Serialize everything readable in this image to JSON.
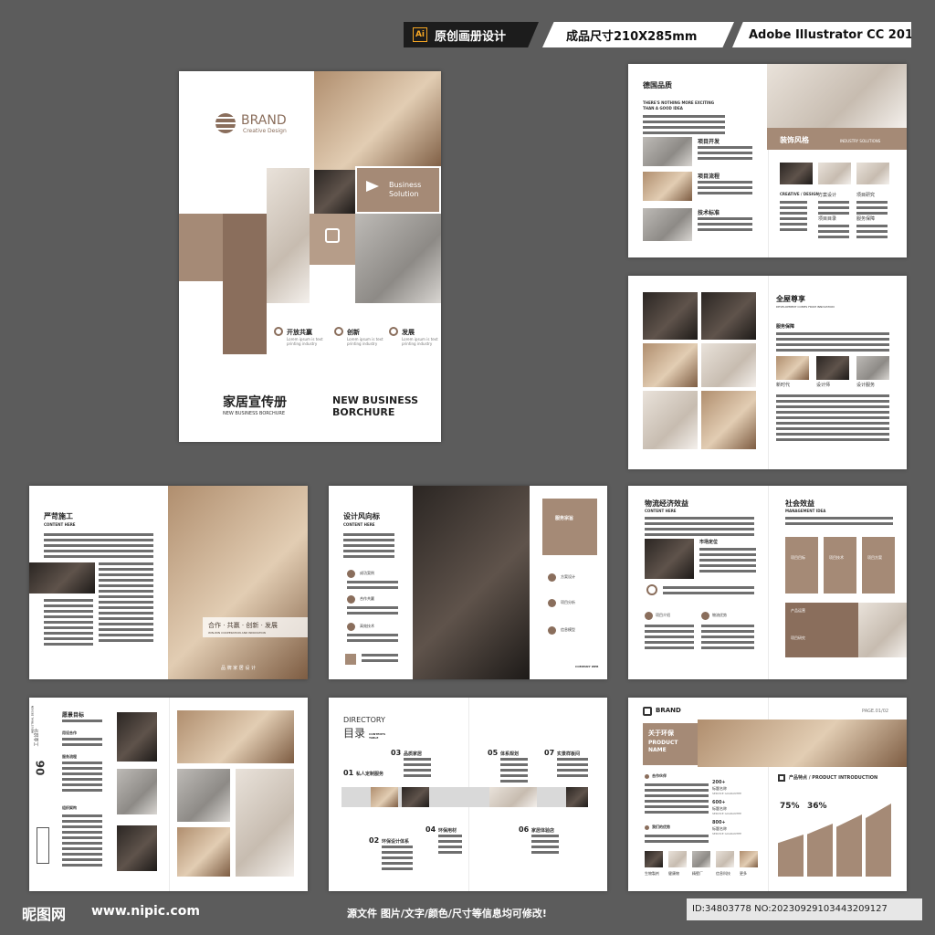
{
  "header": {
    "ai_icon": "Ai",
    "badge1": "原创画册设计",
    "badge2": "成品尺寸210X285mm",
    "badge3": "Adobe Illustrator CC 2018"
  },
  "cover": {
    "brand": "BRAND",
    "brand_sub": "Creative Design",
    "business": "Business",
    "solution": "Solution",
    "features": [
      {
        "label": "开放共赢",
        "text": "Lorem ipsum is text printing industry"
      },
      {
        "label": "创新",
        "text": "Lorem ipsum is text printing industry"
      },
      {
        "label": "发展",
        "text": "Lorem ipsum is text printing industry"
      }
    ],
    "title_cn": "家居宣传册",
    "title_en_small": "NEW BUSINESS BORCHURE",
    "title_en_1": "NEW BUSINESS",
    "title_en_2": "BORCHURE"
  },
  "spread1": {
    "title": "德国品质",
    "tagline_1": "THERE'S NOTHING MORE EXCITING",
    "tagline_2": "THAN A GOOD IDEA",
    "items": [
      "项目开发",
      "项目流程",
      "技术标准"
    ],
    "banner": "装饰风格",
    "banner_en": "INDUSTRY SOLUTIONS",
    "sub_left": "CREATIVE / DESIGN",
    "sub_items": [
      "方案设计",
      "项目研究",
      "项目目录",
      "服务保障",
      "项目目标",
      "服务技术"
    ]
  },
  "spread2": {
    "title": "全屋尊享",
    "subtitle": "DEVELOPMENT COMES FROM INNOVATION",
    "label": "服务保障",
    "caps": [
      "新时代",
      "设计师",
      "设计服务"
    ]
  },
  "spread3": {
    "title": "严苛施工",
    "content": "CONTENT HERE",
    "ribbon": "合作 · 共赢 · 创新 · 发展",
    "ribbon_en": "WIN-WIN COOPERATION AND INNOVATION",
    "footer": "品 牌 家 居 设 计"
  },
  "spread4": {
    "title": "设计风向标",
    "content": "CONTENT HERE",
    "items_left": [
      "成功案例",
      "合作共赢",
      "高效技术"
    ],
    "box_title": "服务宗旨",
    "items_right": [
      "方案设计",
      "项目分析",
      "信息模型"
    ],
    "footer": "COMPANY WEB"
  },
  "spread5": {
    "title_left": "物流经济效益",
    "content": "CONTENT HERE",
    "title_right": "社会效益",
    "mgmt": "MANAGEMENT IDEA",
    "market": "市场定位",
    "cards": [
      "项目目标",
      "项目技术",
      "项目方案"
    ],
    "bottom": [
      "项目介绍",
      "物流优势"
    ],
    "panel_1": "产品运营",
    "panel_2": "项目研究"
  },
  "spread6": {
    "title": "愿景目标",
    "vert_num": "06",
    "vert_cn": "工业设计",
    "vert_en": "INDUSTRIAL DESIGN",
    "items": [
      "用设合作",
      "服务流程",
      "组织架构"
    ]
  },
  "spread7": {
    "dir": "DIRECTORY",
    "dir_cn": "目录",
    "contents": "CONTENTS TABLE",
    "entries": [
      {
        "n": "01",
        "t": "私人定制服务"
      },
      {
        "n": "02",
        "t": "环保设计体系"
      },
      {
        "n": "03",
        "t": "品质家居"
      },
      {
        "n": "04",
        "t": "环保用材"
      },
      {
        "n": "05",
        "t": "体系规划"
      },
      {
        "n": "06",
        "t": "家居体验店"
      },
      {
        "n": "07",
        "t": "实景样板间"
      }
    ]
  },
  "spread8": {
    "brand": "BRAND",
    "page": "PAGE.01/02",
    "box_cn": "关于环保",
    "box_en_1": "PRODUCT",
    "box_en_2": "NAME",
    "label_1": "合作伙伴",
    "label_2": "我们的优势",
    "stat_1": "200+",
    "stat_1_label": "标题名称",
    "stat_1_sub": "SERVICE GUARANTEE",
    "stat_2": "600+",
    "stat_2_label": "标题名称",
    "stat_2_sub": "SERVICE GUARANTEE",
    "stat_3": "800+",
    "stat_3_label": "标题名称",
    "stat_3_sub": "SERVICE GUARANTEE",
    "intro": "产品特点 / PRODUCT INTRODUCTION",
    "pct_1": "75%",
    "pct_2": "36%",
    "thumbs": [
      "生物製剂",
      "健康物",
      "精壁厂",
      "信息科技",
      "更多"
    ]
  },
  "footer": {
    "logo": "昵图网",
    "url": "www.nipic.com",
    "middle": "源文件 图片/文字/颜色/尺寸等信息均可修改!",
    "id": "ID:34803778 NO:20230929103443209127"
  }
}
